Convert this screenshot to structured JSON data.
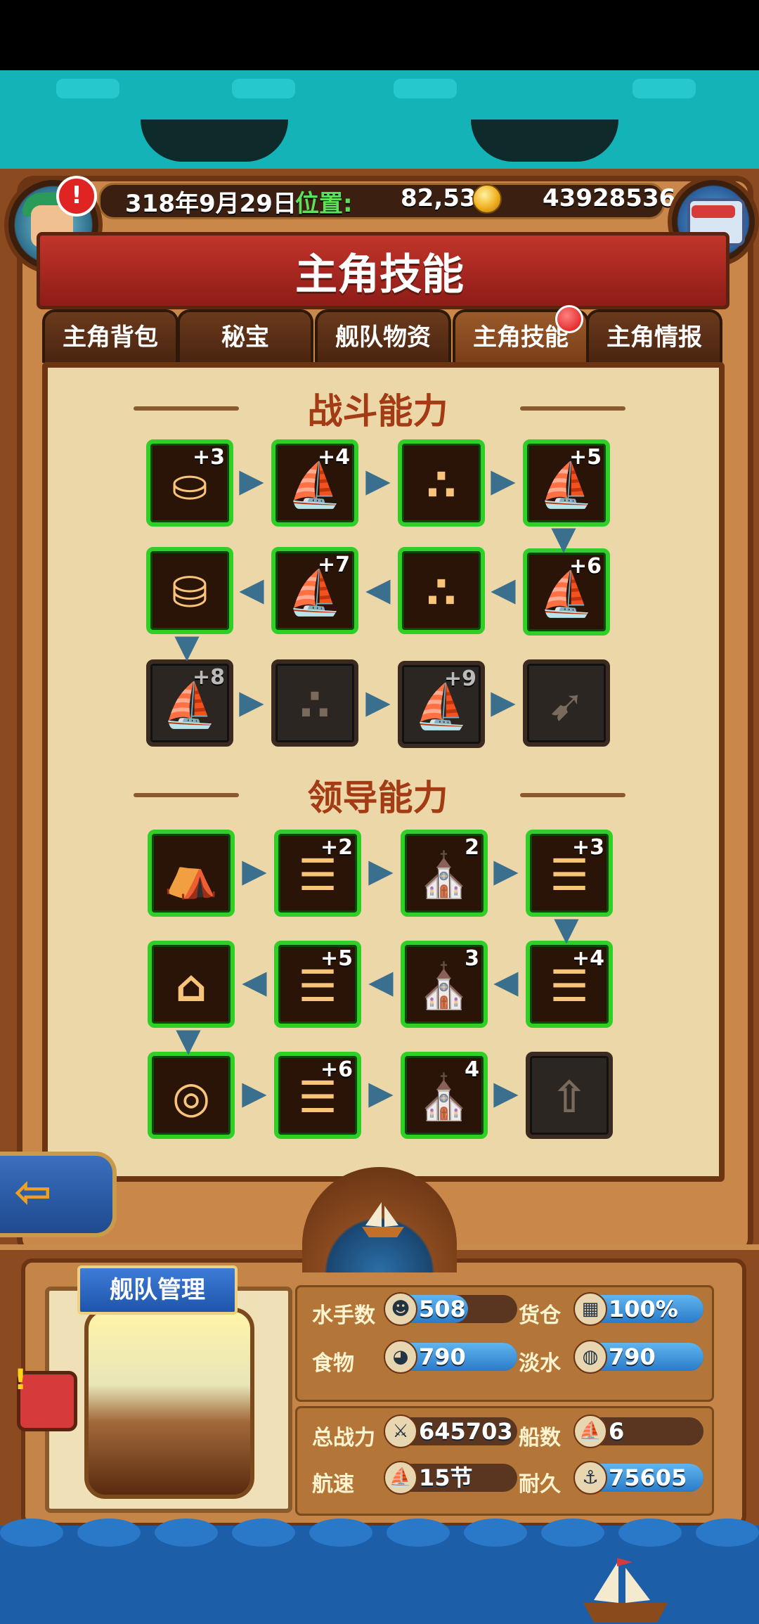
{
  "status": {
    "date": "318年9月29日",
    "position_label": "位置:",
    "position_value": "82,53",
    "gold": "43928536",
    "alert": "!"
  },
  "title": "主角技能",
  "tabs": [
    {
      "label": "主角背包",
      "active": false
    },
    {
      "label": "秘宝",
      "active": false
    },
    {
      "label": "舰队物资",
      "active": false
    },
    {
      "label": "主角技能",
      "active": true
    },
    {
      "label": "主角情报",
      "active": false
    }
  ],
  "combat": {
    "title": "战斗能力",
    "nodes": [
      {
        "icon": "cannon-icon",
        "bonus": "+3",
        "unlocked": true
      },
      {
        "icon": "sail-icon",
        "bonus": "+4",
        "unlocked": true
      },
      {
        "icon": "formation-icon",
        "bonus": "",
        "unlocked": true
      },
      {
        "icon": "fleet-icon",
        "bonus": "+5",
        "unlocked": true
      },
      {
        "icon": "fleet-icon",
        "bonus": "+6",
        "unlocked": true
      },
      {
        "icon": "formation-icon",
        "bonus": "",
        "unlocked": true
      },
      {
        "icon": "fleet-icon",
        "bonus": "+7",
        "unlocked": true
      },
      {
        "icon": "cannon-barrels-icon",
        "bonus": "",
        "unlocked": true
      },
      {
        "icon": "fleet-icon",
        "bonus": "+8",
        "unlocked": false
      },
      {
        "icon": "formation-icon",
        "bonus": "",
        "unlocked": false
      },
      {
        "icon": "fleet-icon",
        "bonus": "+9",
        "unlocked": false
      },
      {
        "icon": "cannonball-icon",
        "bonus": "",
        "unlocked": false
      }
    ]
  },
  "leadership": {
    "title": "领导能力",
    "nodes": [
      {
        "icon": "market-icon",
        "bonus": "",
        "unlocked": true
      },
      {
        "icon": "dock-icon",
        "bonus": "+2",
        "unlocked": true
      },
      {
        "icon": "church-icon",
        "bonus": "2",
        "unlocked": true
      },
      {
        "icon": "dock-icon",
        "bonus": "+3",
        "unlocked": true
      },
      {
        "icon": "dock-icon",
        "bonus": "+4",
        "unlocked": true
      },
      {
        "icon": "church-icon",
        "bonus": "3",
        "unlocked": true
      },
      {
        "icon": "dock-icon",
        "bonus": "+5",
        "unlocked": true
      },
      {
        "icon": "fortress-icon",
        "bonus": "",
        "unlocked": true
      },
      {
        "icon": "wheel-icon",
        "bonus": "",
        "unlocked": true
      },
      {
        "icon": "dock-icon",
        "bonus": "+6",
        "unlocked": true
      },
      {
        "icon": "church-icon",
        "bonus": "4",
        "unlocked": true
      },
      {
        "icon": "coin-upgrade-icon",
        "bonus": "",
        "unlocked": false
      }
    ]
  },
  "fleet": {
    "banner": "舰队管理",
    "stats": {
      "sailors_label": "水手数",
      "sailors": "508",
      "cargo_label": "货仓",
      "cargo": "100%",
      "food_label": "食物",
      "food": "790",
      "water_label": "淡水",
      "water": "790",
      "power_label": "总战力",
      "power": "645703",
      "ships_label": "船数",
      "ships": "6",
      "speed_label": "航速",
      "speed": "15节",
      "durability_label": "耐久",
      "durability": "75605"
    }
  },
  "colors": {
    "unlocked_border": "#2fcf28",
    "title_red": "#a33b14",
    "bar_blue": "#2b7bc9"
  }
}
